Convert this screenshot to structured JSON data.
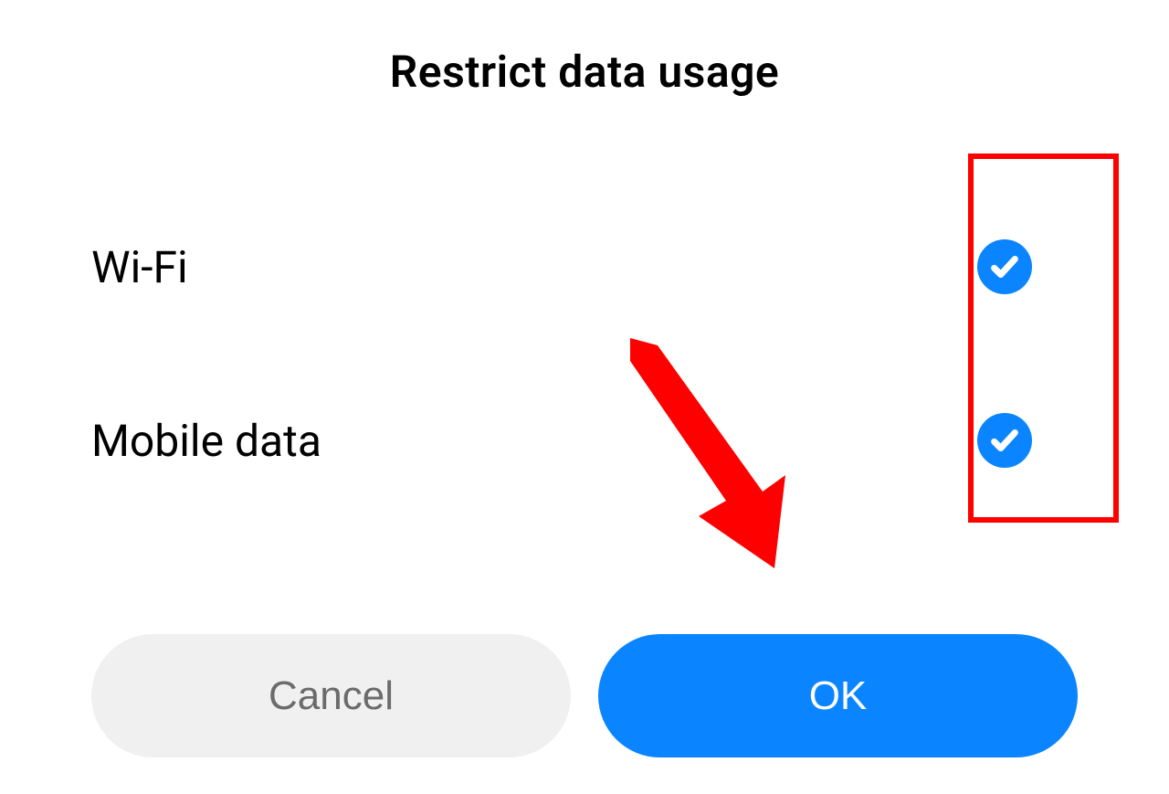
{
  "dialog": {
    "title": "Restrict data usage",
    "options": [
      {
        "label": "Wi-Fi",
        "checked": true
      },
      {
        "label": "Mobile data",
        "checked": true
      }
    ],
    "buttons": {
      "cancel": "Cancel",
      "ok": "OK"
    }
  },
  "colors": {
    "accent": "#0b85ff",
    "cancel_bg": "#f0f0f0",
    "cancel_fg": "#6b6b6b",
    "annotation": "#ff0000"
  }
}
